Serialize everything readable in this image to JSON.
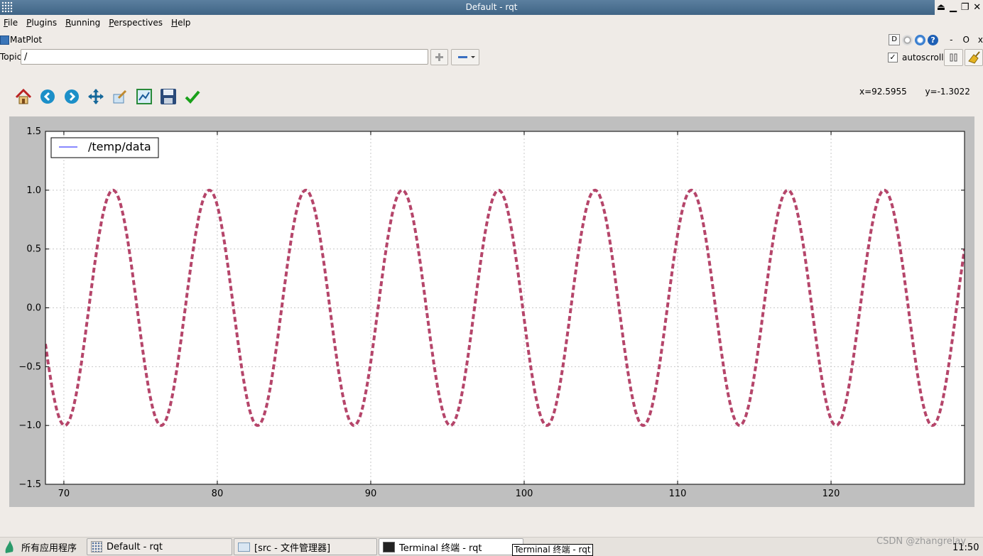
{
  "window": {
    "title": "Default - rqt"
  },
  "menu": [
    "File",
    "Plugins",
    "Running",
    "Perspectives",
    "Help"
  ],
  "plugin": {
    "title": "MatPlot",
    "d_label": "D",
    "dash_label": "-",
    "o_label": "O"
  },
  "topic": {
    "label": "Topic",
    "value": "/",
    "autoscroll_label": "autoscroll",
    "autoscroll_checked": true
  },
  "toolbar_icons": [
    "home-icon",
    "back-arrow-icon",
    "forward-arrow-icon",
    "pan-icon",
    "zoom-rect-icon",
    "subplots-icon",
    "save-icon",
    "edit-curves-icon"
  ],
  "coords": {
    "x": "x=92.5955",
    "y": "y=-1.3022"
  },
  "chart_data": {
    "type": "line",
    "xlim": [
      68.8,
      128.7
    ],
    "ylim": [
      -1.5,
      1.5
    ],
    "x_ticks": [
      70,
      80,
      90,
      100,
      110,
      120
    ],
    "x_tick_labels": [
      "70",
      "80",
      "90",
      "100",
      "110",
      "120"
    ],
    "y_ticks": [
      -1.5,
      -1.0,
      -0.5,
      0.0,
      0.5,
      1.0,
      1.5
    ],
    "y_tick_labels": [
      "−1.5",
      "−1.0",
      "−0.5",
      "0.0",
      "0.5",
      "1.0",
      "1.5"
    ],
    "grid": true,
    "legend_position": "top-left",
    "legend_line_color": "#6060ff",
    "series": [
      {
        "name": "/temp/data",
        "color": "#b5456a",
        "style": "dashed",
        "function": "sin",
        "amplitude": 1.0,
        "period": 6.2832,
        "peak_x": 73.2,
        "peaks_x": [
          73.2,
          79.5,
          85.8,
          92.0,
          98.3,
          104.6,
          110.9,
          117.2,
          123.5
        ],
        "troughs_x": [
          70.0,
          76.3,
          82.6,
          88.9,
          95.2,
          101.5,
          107.8,
          114.0,
          120.3,
          126.6
        ]
      }
    ]
  },
  "taskbar": {
    "start_label": "所有应用程序",
    "tasks": [
      "Default - rqt",
      "[src - 文件管理器]",
      "Terminal 终端 - rqt"
    ],
    "tooltip": "Terminal 终端 - rqt",
    "clock": "11:50",
    "watermark": "CSDN @zhangrelay"
  }
}
